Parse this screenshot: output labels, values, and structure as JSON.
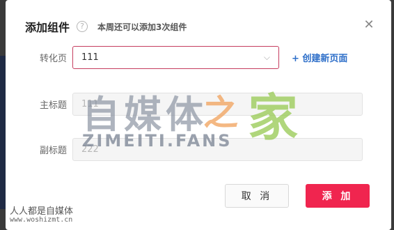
{
  "dialog": {
    "title": "添加组件",
    "help_icon": "?",
    "subtitle": "本周还可以添加3次组件",
    "close_icon": "✕"
  },
  "form": {
    "conversion_page": {
      "label": "转化页",
      "value": "111",
      "chevron": "⌵",
      "create_link": "+ 创建新页面"
    },
    "main_title": {
      "label": "主标题",
      "value": "111"
    },
    "sub_title": {
      "label": "副标题",
      "value": "222"
    }
  },
  "buttons": {
    "cancel": "取 消",
    "add": "添 加"
  },
  "watermark": {
    "big_text": "自媒体",
    "zhi": "之",
    "jia": "家",
    "english": "ZIMEITI.FANS",
    "corner_brand": "人人都是自媒体",
    "corner_url": "www.woshizmt.cn"
  },
  "colors": {
    "accent": "#f0254f",
    "link": "#2e6fc9",
    "select_border": "#c63d5f"
  }
}
